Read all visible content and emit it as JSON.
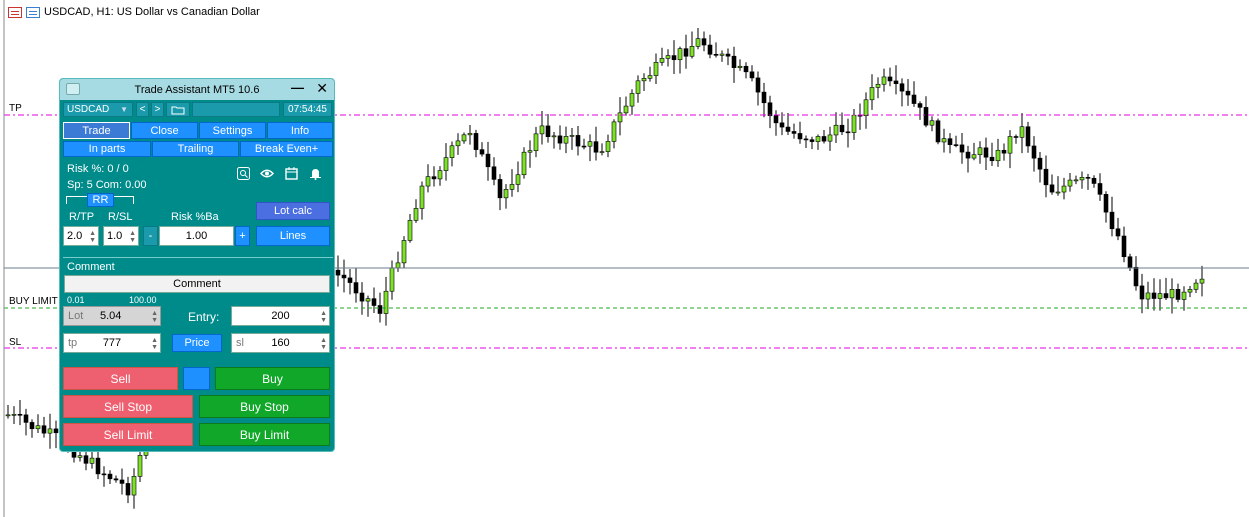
{
  "window": {
    "title": "USDCAD, H1:  US Dollar vs Canadian Dollar"
  },
  "levels": {
    "tp": "TP",
    "buy_limit": "BUY LIMIT",
    "sl": "SL"
  },
  "panel": {
    "title": "Trade Assistant MT5 10.6",
    "minimize": "—",
    "close": "✕",
    "symbol": "USDCAD",
    "prev": "<",
    "next": ">",
    "time": "07:54:45",
    "tabs": [
      "Trade",
      "Close",
      "Settings",
      "Info"
    ],
    "subtabs": [
      "In parts",
      "Trailing",
      "Break Even+"
    ],
    "risk_text": "Risk %: 0 / 0",
    "spread_text": "Sp: 5  Com: 0.00",
    "rr_label": "RR",
    "rtp_label": "R/TP",
    "rsl_label": "R/SL",
    "risk_ba_label": "Risk %Ba",
    "lot_calc": "Lot calc",
    "lines": "Lines",
    "rtp_value": "2.0",
    "rsl_value": "1.0",
    "risk_value": "1.00",
    "minus": "-",
    "plus": "+",
    "comment_label": "Comment",
    "comment_value": "Comment",
    "lot_min": "0.01",
    "lot_max": "100.00",
    "lot_label": "Lot",
    "lot_value": "5.04",
    "entry_label": "Entry:",
    "entry_value": "200",
    "tp_label": "tp",
    "tp_value": "777",
    "price_button": "Price",
    "sl_label": "sl",
    "sl_value": "160",
    "sell": "Sell",
    "buy": "Buy",
    "sell_stop": "Sell Stop",
    "buy_stop": "Buy Stop",
    "sell_limit": "Sell Limit",
    "buy_limit": "Buy Limit"
  },
  "colors": {
    "bull": "#7ee02a",
    "bear": "#000000",
    "tp_line": "#e000e0",
    "sl_line": "#e000e0",
    "entry_line": "#22aa22",
    "price_line": "#6b7b8c",
    "panel_bg": "#008b8b"
  }
}
